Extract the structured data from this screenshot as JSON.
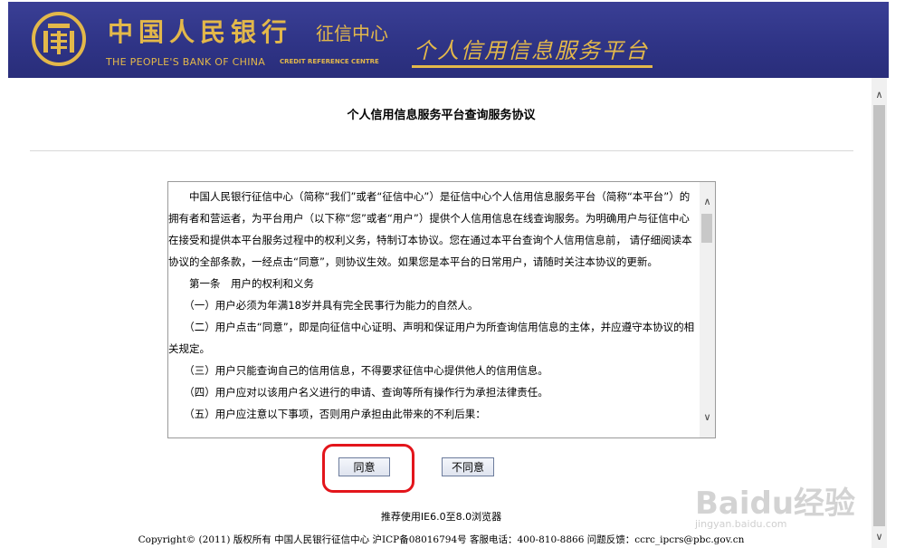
{
  "header": {
    "bank_name_cn": "中国人民银行",
    "centre_name_cn": "征信中心",
    "bank_name_en": "THE PEOPLE'S BANK OF CHINA",
    "centre_name_en": "CREDIT REFERENCE CENTRE",
    "platform_name": "个人信用信息服务平台"
  },
  "page_title": "个人信用信息服务平台查询服务协议",
  "agreement": {
    "paragraphs": [
      "　　中国人民银行征信中心（简称“我们”或者“征信中心”）是征信中心个人信用信息服务平台（简称“本平台”）的拥有者和营运者，为平台用户（以下称“您”或者“用户”）提供个人信用信息在线查询服务。为明确用户与征信中心在接受和提供本平台服务过程中的权利义务，特制订本协议。您在通过本平台查询个人信用信息前， 请仔细阅读本协议的全部条款，一经点击“同意”，则协议生效。如果您是本平台的日常用户，请随时关注本协议的更新。",
      "　　第一条　用户的权利和义务",
      "　　（一）用户必须为年满18岁并具有完全民事行为能力的自然人。",
      "　　（二）用户点击“同意”，即是向征信中心证明、声明和保证用户为所查询信用信息的主体，并应遵守本协议的相关规定。",
      "　　（三）用户只能查询自己的信用信息，不得要求征信中心提供他人的信用信息。",
      "　　（四）用户应对以该用户名义进行的申请、查询等所有操作行为承担法律责任。",
      "　　（五）用户应注意以下事项，否则用户承担由此带来的不利后果："
    ]
  },
  "buttons": {
    "agree": "同意",
    "disagree": "不同意"
  },
  "footer": {
    "browser_note": "推荐使用IE6.0至8.0浏览器",
    "copyright": "Copyright© (2011) 版权所有 中国人民银行征信中心 沪ICP备08016794号 客服电话：400-810-8866 问题反馈：ccrc_ipcrs@pbc.gov.cn"
  },
  "watermark": {
    "text": "Baidu经验",
    "url": "jingyan.baidu.com"
  },
  "colors": {
    "banner": "#2f3486",
    "gold": "#e3b84a",
    "highlight": "#e3151b"
  }
}
